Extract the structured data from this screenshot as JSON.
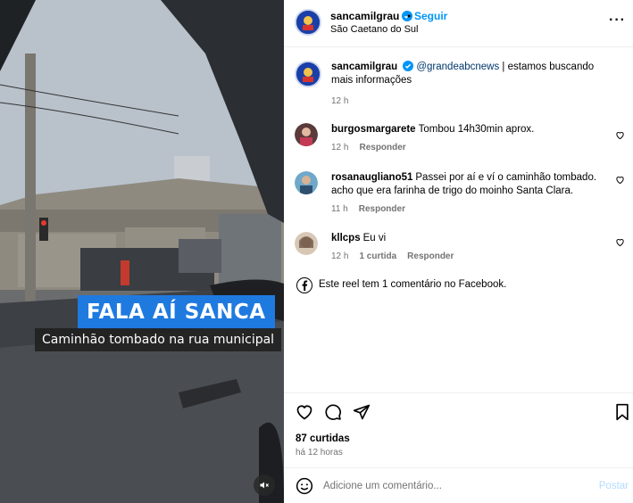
{
  "video": {
    "caption_title": "FALA AÍ SANCA",
    "caption_subtitle": "Caminhão tombado na rua municipal",
    "mute_icon": "speaker-muted-icon"
  },
  "header": {
    "username": "sancamilgrau",
    "separator": "•",
    "follow_label": "Seguir",
    "location": "São Caetano do Sul",
    "more_icon": "more-horizontal-icon",
    "more_label": "···"
  },
  "caption": {
    "username": "sancamilgrau",
    "mention": "@grandeabcnews",
    "text": " | estamos buscando mais informações",
    "time": "12 h"
  },
  "comments": [
    {
      "username": "burgosmargarete",
      "text": "Tombou 14h30min aprox.",
      "time": "12 h",
      "likes": "",
      "reply": "Responder"
    },
    {
      "username": "rosanaugliano51",
      "text": "Passei por aí e ví o caminhão tombado. acho que era farinha de trigo do moinho Santa Clara.",
      "time": "11 h",
      "likes": "",
      "reply": "Responder"
    },
    {
      "username": "kllcps",
      "text": "Eu vi",
      "time": "12 h",
      "likes": "1 curtida",
      "reply": "Responder"
    }
  ],
  "facebook_note": "Este reel tem 1 comentário no Facebook.",
  "actions": {
    "likes": "87 curtidas",
    "time": "há 12 horas"
  },
  "composer": {
    "placeholder": "Adicione um comentário...",
    "post_label": "Postar"
  },
  "colors": {
    "link_blue": "#0095f6",
    "caption_blue": "#1f7ae0",
    "muted_text": "#737373",
    "post_disabled": "#b3dbff"
  }
}
